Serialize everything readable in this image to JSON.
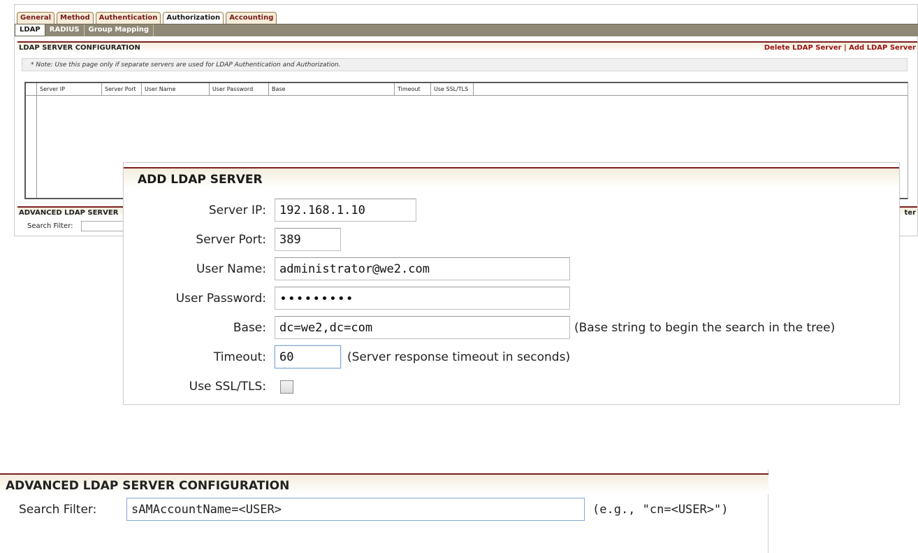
{
  "tabs": {
    "top": [
      "General",
      "Method",
      "Authentication",
      "Authorization",
      "Accounting"
    ],
    "active_top": "Authorization",
    "sub": [
      "LDAP",
      "RADIUS",
      "Group Mapping"
    ],
    "active_sub": "LDAP"
  },
  "ldap_config": {
    "title": "LDAP SERVER CONFIGURATION",
    "delete_link": "Delete LDAP Server",
    "separator": "|",
    "add_link": "Add LDAP Server",
    "note": "* Note: Use this page only if separate servers are used for LDAP Authentication and Authorization.",
    "columns": [
      "Server IP",
      "Server Port",
      "User Name",
      "User Password",
      "Base",
      "Timeout",
      "Use SSL/TLS"
    ]
  },
  "adv_small": {
    "title": "ADVANCED LDAP SERVER",
    "trunc_right": "ter",
    "filter_label": "Search Filter:"
  },
  "add_server": {
    "title": "ADD LDAP SERVER",
    "server_ip_label": "Server IP:",
    "server_ip": "192.168.1.10",
    "server_port_label": "Server Port:",
    "server_port": "389",
    "user_name_label": "User Name:",
    "user_name": "administrator@we2.com",
    "user_password_label": "User Password:",
    "user_password": "•••••••••",
    "base_label": "Base:",
    "base": "dc=we2,dc=com",
    "base_hint": "(Base string to begin the search in the tree)",
    "timeout_label": "Timeout:",
    "timeout": "60",
    "timeout_hint": "(Server response timeout in seconds)",
    "ssl_label": "Use SSL/TLS:",
    "ssl_checked": false
  },
  "advanced": {
    "title": "ADVANCED LDAP SERVER CONFIGURATION",
    "search_filter_label": "Search Filter:",
    "search_filter": "sAMAccountName=<USER>",
    "search_filter_hint": "(e.g., \"cn=<USER>\")"
  },
  "colors": {
    "accent_border": "#7c1f1f",
    "link_red": "#9b1111",
    "tab_bar": "#8f8a76"
  }
}
